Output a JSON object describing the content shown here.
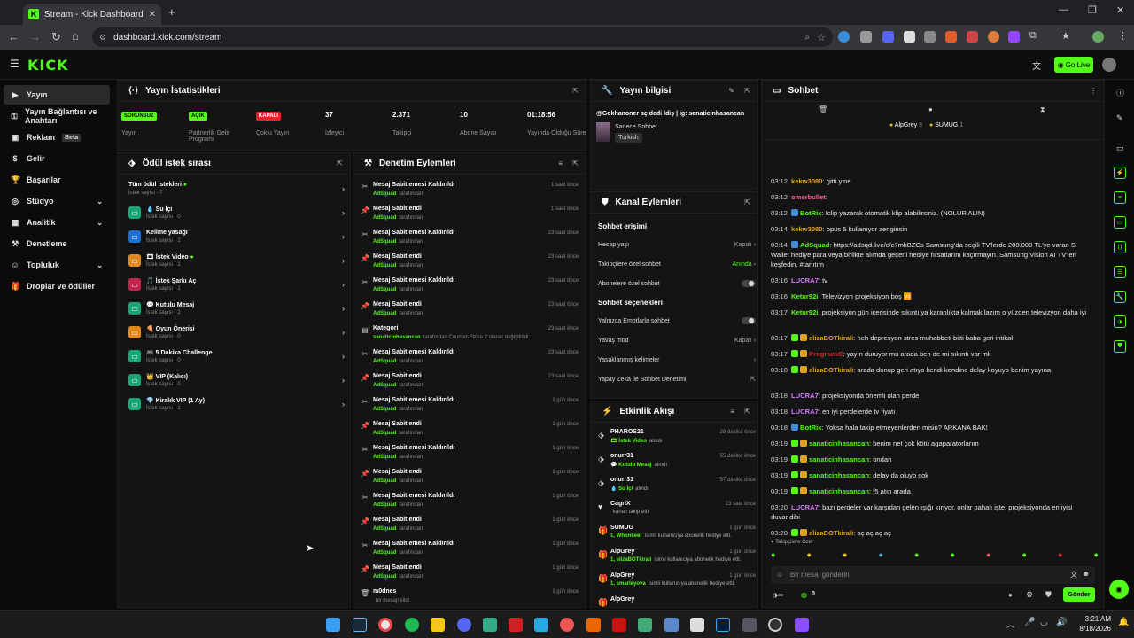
{
  "browser": {
    "tab_title": "Stream - Kick Dashboard",
    "url": "dashboard.kick.com/stream"
  },
  "app": {
    "logo": "KICK",
    "go_live": "Go Live"
  },
  "sidebar": {
    "items": [
      {
        "label": "Yayın",
        "icon": "video-icon",
        "active": true
      },
      {
        "label": "Yayın Bağlantısı ve Anahtarı",
        "icon": "key-icon"
      },
      {
        "label": "Reklam",
        "icon": "ad-icon",
        "badge": "Beta"
      },
      {
        "label": "Gelir",
        "icon": "dollar-icon"
      },
      {
        "label": "Başarılar",
        "icon": "trophy-icon"
      },
      {
        "label": "Stüdyo",
        "icon": "studio-icon",
        "chevron": true
      },
      {
        "label": "Analitik",
        "icon": "chart-icon",
        "chevron": true
      },
      {
        "label": "Denetleme",
        "icon": "hammer-icon"
      },
      {
        "label": "Topluluk",
        "icon": "users-icon",
        "chevron": true
      },
      {
        "label": "Droplar ve ödüller",
        "icon": "gift-icon"
      }
    ]
  },
  "stats": {
    "title": "Yayın İstatistikleri",
    "items": [
      {
        "tag": "SORUNSUZ",
        "tag_color": "#53fc18",
        "label": "Yayın"
      },
      {
        "tag": "AÇIK",
        "tag_color": "#53fc18",
        "label": "Partnerlik Gelir Programı"
      },
      {
        "tag": "KAPALI",
        "tag_color": "#e0252b",
        "label": "Çoklu Yayın"
      },
      {
        "value": "37",
        "label": "İzleyici"
      },
      {
        "value": "2.371",
        "label": "Takipçi"
      },
      {
        "value": "10",
        "label": "Abone Sayısı"
      },
      {
        "value": "01:18:56",
        "label": "Yayında Olduğu Süre"
      }
    ]
  },
  "stream_info": {
    "title": "Yayın bilgisi",
    "stream_title": "@Gokhanoner aç dedi ldiş | ig: sanaticinhasancan",
    "chat_mode": "Sadece Sohbet",
    "language": "Turkish"
  },
  "rewards": {
    "title": "Ödül istek sırası",
    "all_label": "Tüm ödül istekleri",
    "all_count": "İstek sayısı - 7",
    "items": [
      {
        "name": "💧 Su İçi",
        "count": "İstek sayısı - 0",
        "color": "#17a673"
      },
      {
        "name": "Kelime yasağı",
        "count": "İstek sayısı - 2",
        "color": "#1f6fd1"
      },
      {
        "name": "🎞 İstek Video",
        "count": "İstek sayısı - 1",
        "color": "#e08a1e",
        "dot": true
      },
      {
        "name": "🎵 İstek Şarkı Aç",
        "count": "İstek sayısı - 1",
        "color": "#c4234b"
      },
      {
        "name": "💬 Kutulu Mesaj",
        "count": "İstek sayısı - 2",
        "color": "#17a673"
      },
      {
        "name": "🍕 Oyun Önerisi",
        "count": "İstek sayısı - 0",
        "color": "#e08a1e"
      },
      {
        "name": "🎮 5 Dakika Challenge",
        "count": "İstek sayısı - 0",
        "color": "#17a673"
      },
      {
        "name": "👑 VIP (Kalıcı)",
        "count": "İstek sayısı - 0",
        "color": "#17a673"
      },
      {
        "name": "💎 Kiralık VIP (1 Ay)",
        "count": "İstek sayısı - 1",
        "color": "#17a673"
      }
    ]
  },
  "modlog": {
    "title": "Denetim Eylemleri",
    "items": [
      {
        "action": "Mesaj Sabitlemesi Kaldırıldı",
        "by": "AdSquad",
        "suffix": "tarafından",
        "time": "1 saat önce",
        "icon": "unpin-icon"
      },
      {
        "action": "Mesaj Sabitlendi",
        "by": "AdSquad",
        "suffix": "tarafından",
        "time": "1 saat önce",
        "icon": "pin-icon"
      },
      {
        "action": "Mesaj Sabitlemesi Kaldırıldı",
        "by": "AdSquad",
        "suffix": "tarafından",
        "time": "23 saat önce",
        "icon": "unpin-icon"
      },
      {
        "action": "Mesaj Sabitlendi",
        "by": "AdSquad",
        "suffix": "tarafından",
        "time": "23 saat önce",
        "icon": "pin-icon"
      },
      {
        "action": "Mesaj Sabitlemesi Kaldırıldı",
        "by": "AdSquad",
        "suffix": "tarafından",
        "time": "23 saat önce",
        "icon": "unpin-icon"
      },
      {
        "action": "Mesaj Sabitlendi",
        "by": "AdSquad",
        "suffix": "tarafından",
        "time": "23 saat önce",
        "icon": "pin-icon"
      },
      {
        "action": "Kategori",
        "by": "sanaticinhasancan",
        "suffix": "tarafından Counter-Strike 2 olarak değiştirildi",
        "time": "23 saat önce",
        "icon": "category-icon"
      },
      {
        "action": "Mesaj Sabitlemesi Kaldırıldı",
        "by": "AdSquad",
        "suffix": "tarafından",
        "time": "23 saat önce",
        "icon": "unpin-icon"
      },
      {
        "action": "Mesaj Sabitlendi",
        "by": "AdSquad",
        "suffix": "tarafından",
        "time": "23 saat önce",
        "icon": "pin-icon"
      },
      {
        "action": "Mesaj Sabitlemesi Kaldırıldı",
        "by": "AdSquad",
        "suffix": "tarafından",
        "time": "1 gün önce",
        "icon": "unpin-icon"
      },
      {
        "action": "Mesaj Sabitlendi",
        "by": "AdSquad",
        "suffix": "tarafından",
        "time": "1 gün önce",
        "icon": "pin-icon"
      },
      {
        "action": "Mesaj Sabitlemesi Kaldırıldı",
        "by": "AdSquad",
        "suffix": "tarafından",
        "time": "1 gün önce",
        "icon": "unpin-icon"
      },
      {
        "action": "Mesaj Sabitlendi",
        "by": "AdSquad",
        "suffix": "tarafından",
        "time": "1 gün önce",
        "icon": "pin-icon"
      },
      {
        "action": "Mesaj Sabitlemesi Kaldırıldı",
        "by": "AdSquad",
        "suffix": "tarafından",
        "time": "1 gün önce",
        "icon": "unpin-icon"
      },
      {
        "action": "Mesaj Sabitlendi",
        "by": "AdSquad",
        "suffix": "tarafından",
        "time": "1 gün önce",
        "icon": "pin-icon"
      },
      {
        "action": "Mesaj Sabitlemesi Kaldırıldı",
        "by": "AdSquad",
        "suffix": "tarafından",
        "time": "1 gün önce",
        "icon": "unpin-icon"
      },
      {
        "action": "Mesaj Sabitlendi",
        "by": "AdSquad",
        "suffix": "tarafından",
        "time": "1 gün önce",
        "icon": "pin-icon"
      },
      {
        "action": "m0dnes",
        "by": "",
        "suffix": "bir mesajı sildi",
        "time": "1 gün önce",
        "icon": "trash-icon"
      }
    ]
  },
  "channel": {
    "title": "Kanal Eylemleri",
    "chat_access": "Sohbet erişimi",
    "account_age": "Hesap yaşı",
    "account_age_val": "Kapalı",
    "followers_only": "Takipçilere özel sohbet",
    "followers_only_val": "Anında",
    "subs_only": "Abonelere özel sohbet",
    "chat_options": "Sohbet seçenekleri",
    "emotes_only": "Yalnızca Emotlarla sohbet",
    "slow_mode": "Yavaş mod",
    "slow_mode_val": "Kapalı",
    "banned_words": "Yasaklanmış kelimeler",
    "ai_mod": "Yapay Zeka ile Sohbet Denetimi"
  },
  "activity": {
    "title": "Etkinlik Akışı",
    "items": [
      {
        "name": "PHAROS21",
        "desc_b": "🎞 İstek Video",
        "desc": "alındı",
        "time": "28 dakika önce",
        "icon": "reward-icon"
      },
      {
        "name": "onurr31",
        "desc_b": "💬 Kutulu Mesaj",
        "desc": "alındı",
        "time": "55 dakika önce",
        "icon": "reward-icon"
      },
      {
        "name": "onurr31",
        "desc_b": "💧 Su İçi",
        "desc": "alındı",
        "time": "57 dakika önce",
        "icon": "reward-icon"
      },
      {
        "name": "CagriX",
        "desc_b": "",
        "desc": "kanalı takip etti",
        "time": "23 saat önce",
        "icon": "heart-icon"
      },
      {
        "name": "SUMUG",
        "desc_b": "1, Whonkeer",
        "desc": "isimli kullanıcıya abonelik hediye etti.",
        "time": "1 gün önce",
        "icon": "gift-icon"
      },
      {
        "name": "AlpGrey",
        "desc_b": "1, elizaBOTkirali",
        "desc": "isimli kullanıcıya abonelik hediye etti.",
        "time": "1 gün önce",
        "icon": "gift-icon"
      },
      {
        "name": "AlpGrey",
        "desc_b": "1, smarleyova",
        "desc": "isimli kullanıcıya abonelik hediye etti.",
        "time": "1 gün önce",
        "icon": "gift-icon"
      },
      {
        "name": "AlpGrey",
        "desc_b": "",
        "desc": "",
        "time": "",
        "icon": "gift-icon"
      }
    ]
  },
  "chat": {
    "title": "Sohbet",
    "gifters": [
      {
        "name": "AlpGrey",
        "count": "3"
      },
      {
        "name": "SUMUG",
        "count": "1"
      }
    ],
    "messages": [
      {
        "time": "03:12",
        "user": "kekw3080",
        "color": "#e0a321",
        "text": "gitti yine"
      },
      {
        "time": "03:12",
        "user": "omerbullet",
        "color": "#ff5e9e",
        "text": ""
      },
      {
        "time": "03:12",
        "user": "BotRix",
        "color": "#53fc18",
        "text": "!clip yazarak otomatik klip alabilirsiniz. (NOLUR ALIN)"
      },
      {
        "time": "03:14",
        "user": "kekw3080",
        "color": "#e0a321",
        "text": "opus 5 kullanıyor zenginsin"
      },
      {
        "time": "03:14",
        "user": "AdSquad",
        "color": "#53fc18",
        "text": "https://adsqd.live/c/c7mkBZCs Samsung'da seçili TV'lerde 200.000 TL'ye varan S Wallet hediye para veya birlikte alımda geçerli hediye fırsatlarını kaçırmayın. Samsung Vision AI TV'leri keşfedin. #tanıtım"
      },
      {
        "time": "03:16",
        "user": "LUCRA7",
        "color": "#d17bff",
        "text": "tv"
      },
      {
        "time": "03:16",
        "user": "Ketur92i",
        "color": "#53fc18",
        "text": "Televizyon projeksiyon boş 🆚"
      },
      {
        "time": "03:17",
        "user": "Ketur92i",
        "color": "#53fc18",
        "text": "projeksiyon gün içerisinde sıkıntı ya karanlıkta kalmak lazım o yüzden televizyon daha iyi"
      },
      {
        "time": "03:17",
        "user": "elizaBOTkirali",
        "color": "#e0a321",
        "text": "heh depresyon stres muhabbeti bitti baba geri intikal"
      },
      {
        "time": "03:17",
        "user": "ProgmenC",
        "color": "#e0252b",
        "text": "yayın duruyor mu arada ben de mi sıkıntı var mk"
      },
      {
        "time": "03:18",
        "user": "elizaBOTkirali",
        "color": "#e0a321",
        "text": "arada donup geri atıyo kendi kendine delay koyuyo benim yayına"
      },
      {
        "time": "03:18",
        "user": "LUCRA7",
        "color": "#d17bff",
        "text": "projeksiyonda önemli olan perde"
      },
      {
        "time": "03:18",
        "user": "LUCRA7",
        "color": "#d17bff",
        "text": "en iyi perdelerde tv fiyatı"
      },
      {
        "time": "03:18",
        "user": "BotRix",
        "color": "#53fc18",
        "text": "Yoksa hala takip etmeyenlerden misin? ARKANA BAK!"
      },
      {
        "time": "03:19",
        "user": "sanaticinhasancan",
        "color": "#53fc18",
        "text": "benim net çok kötü agaparatorlarım"
      },
      {
        "time": "03:19",
        "user": "sanaticinhasancan",
        "color": "#53fc18",
        "text": "ondan"
      },
      {
        "time": "03:19",
        "user": "sanaticinhasancan",
        "color": "#53fc18",
        "text": "delay da oluyo çok"
      },
      {
        "time": "03:19",
        "user": "sanaticinhasancan",
        "color": "#53fc18",
        "text": "f5 atın arada"
      },
      {
        "time": "03:20",
        "user": "LUCRA7",
        "color": "#d17bff",
        "text": "bazı perdeler var karşıdan gelen ışığı kırıyor. onlar pahalı işte. projeksiyonda en iyisi duvar dibi"
      },
      {
        "time": "03:20",
        "user": "elizaBOTkirali",
        "color": "#e0a321",
        "text": "aç aç aç aç"
      }
    ],
    "followers_only_note": "Takipçilere Özel",
    "input_placeholder": "Bir mesaj gönderin",
    "count": "0",
    "send": "Gönder"
  },
  "taskbar": {
    "time": "3:21 AM",
    "date": "8/18/2026"
  }
}
